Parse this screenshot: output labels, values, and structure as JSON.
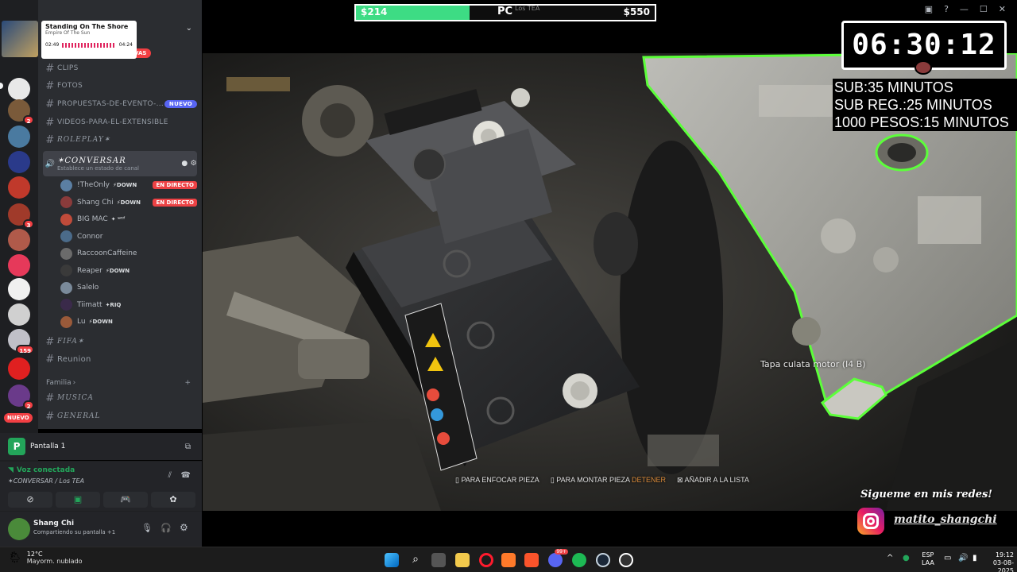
{
  "spotify": {
    "title": "Standing On The Shore",
    "artist": "Empire Of The Sun",
    "elapsed": "02:49",
    "total": "04:24"
  },
  "sidebar": {
    "channels": [
      {
        "name": "CLIPS",
        "badge": ""
      },
      {
        "name": "FOTOS",
        "badge": ""
      },
      {
        "name": "PROPUESTAS-DE-EVENTO-...",
        "badge": "NUEVO"
      },
      {
        "name": "VIDEOS-PARA-EL-EXTENSIBLE",
        "badge": ""
      },
      {
        "name": "ROLEPLAY✶",
        "badge": ""
      }
    ],
    "new_messages_badge": "VAS",
    "voice_channel": {
      "name": "✶CONVERSAR",
      "status": "Establece un estado de canal"
    },
    "voice_users": [
      {
        "name": "!TheOnly",
        "tag": "⚡DOWN",
        "live": "EN DIRECTO",
        "color": "#5b7fa3"
      },
      {
        "name": "Shang Chi",
        "tag": "⚡DOWN",
        "live": "EN DIRECTO",
        "color": "#8a3b3b"
      },
      {
        "name": "BIG MAC",
        "tag": "✦ ʷᵗᶠ",
        "live": "",
        "color": "#c04b3a"
      },
      {
        "name": "Connor",
        "tag": "",
        "live": "",
        "color": "#4b6b8a"
      },
      {
        "name": "RaccoonCaffeine",
        "tag": "",
        "live": "",
        "color": "#6b6b6b"
      },
      {
        "name": "Reaper",
        "tag": "⚡DOWN",
        "live": "",
        "color": "#3a3a3a"
      },
      {
        "name": "Salelo",
        "tag": "",
        "live": "",
        "color": "#7a8a9a"
      },
      {
        "name": "Tiimatt",
        "tag": "✦RIQ",
        "live": "",
        "color": "#3a2a4a"
      },
      {
        "name": "Lu",
        "tag": "⚡DOWN",
        "live": "",
        "color": "#9a5a3a"
      }
    ],
    "more_channels": [
      "FIFA✶",
      "Reunion"
    ],
    "category": "Familia",
    "category_channels": [
      "MUSICA",
      "GENERAL"
    ],
    "server_new": "NUEVO"
  },
  "server_badges": [
    "2",
    "3",
    "159",
    "2"
  ],
  "stream_panel": {
    "label": "Pantalla 1"
  },
  "voice_panel": {
    "status": "Voz conectada",
    "channel": "✶CONVERSAR / Los TEA"
  },
  "user_panel": {
    "name": "Shang Chi",
    "status": "Compartiendo su pantalla +1"
  },
  "overlay": {
    "bar_left": "$214",
    "bar_label": "PC",
    "bar_caption": "Los TEA",
    "bar_right": "$550",
    "bar_fill_fraction": 0.38,
    "timer": "06:30:12",
    "rules": [
      "SUB:35 MINUTOS",
      "SUB REG.:25 MINUTOS",
      "1000 PESOS:15 MINUTOS"
    ],
    "social_title": "Sigueme en mis redes!",
    "social_handle": "matito_shangchi"
  },
  "game": {
    "part_label": "Tapa culata motor (I4 B)",
    "hint_focus": "PARA ENFOCAR PIEZA",
    "hint_mount": "PARA MONTAR PIEZA",
    "hint_mount_extra": "DETENER",
    "hint_add": "AÑADIR A LA LISTA"
  },
  "taskbar": {
    "weather_temp": "12°C",
    "weather_desc": "Mayorm. nublado",
    "lang_top": "ESP",
    "lang_bottom": "LAA",
    "time": "19:12",
    "date": "03-08-2025",
    "notif_badge": "99+"
  },
  "colors": {
    "accent_green": "#3ddc84",
    "discord_blurple": "#5865f2",
    "live_red": "#ed4245",
    "outline_green": "#5cff3a"
  }
}
